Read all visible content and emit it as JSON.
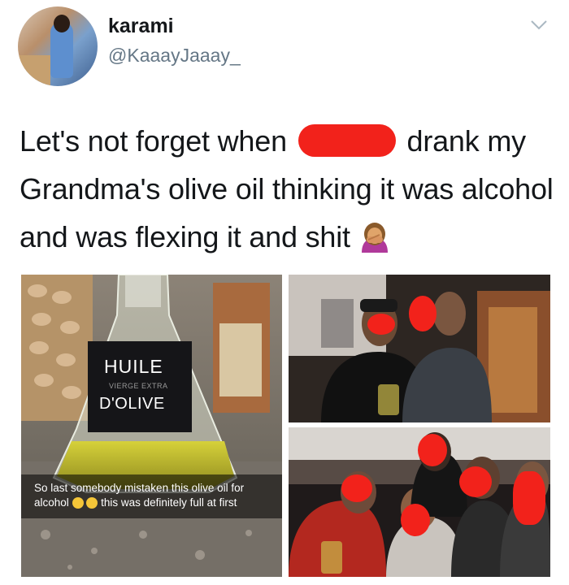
{
  "user": {
    "display_name": "karami",
    "handle": "@KaaayJaaay_",
    "avatar_icon": "profile-avatar"
  },
  "tweet": {
    "text_before_redaction": "Let's not forget when ",
    "text_after_redaction": " drank my Grandma's olive oil thinking it was alcohol and was flexing it and shit",
    "emoji_icon": "face-palm-woman-emoji"
  },
  "menu_icon": "chevron-down-icon",
  "photos": {
    "left": {
      "bottle_label_line1": "HUILE",
      "bottle_label_line2": "VIERGE EXTRA",
      "bottle_label_line3": "D'OLIVE",
      "caption_line1": "So last somebody mistaken this olive oil for",
      "caption_line2_prefix": "alcohol ",
      "caption_line2_suffix": " this was definitely full at first"
    }
  },
  "colors": {
    "redaction": "#f2221b",
    "handle_gray": "#657786",
    "text": "#14171a"
  }
}
